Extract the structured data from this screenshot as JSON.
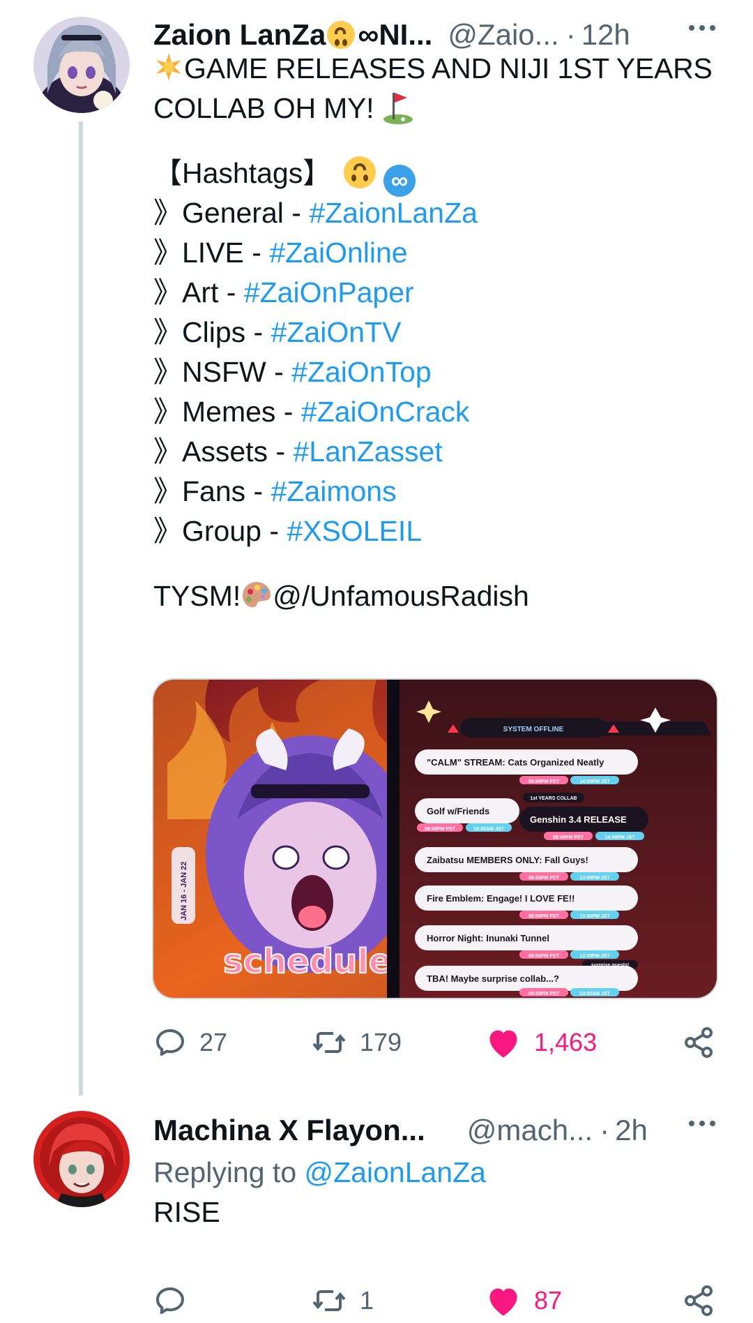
{
  "tweet1": {
    "display_name": "Zaion LanZa",
    "display_name_tail": "NI...",
    "handle": "@Zaio...",
    "separator": "·",
    "time": "12h",
    "lines": {
      "l1": "GAME RELEASES AND NIJI 1ST YEARS",
      "l2": "COLLAB OH MY!",
      "hashtags_header": "【Hashtags】"
    },
    "hashtags": [
      {
        "label": "》General - ",
        "tag": "#ZaionLanZa"
      },
      {
        "label": "》LIVE - ",
        "tag": "#ZaiOnline"
      },
      {
        "label": "》Art - ",
        "tag": "#ZaiOnPaper"
      },
      {
        "label": "》Clips - ",
        "tag": "#ZaiOnTV"
      },
      {
        "label": "》NSFW - ",
        "tag": "#ZaiOnTop"
      },
      {
        "label": "》Memes - ",
        "tag": "#ZaiOnCrack"
      },
      {
        "label": "》Assets - ",
        "tag": "#LanZasset"
      },
      {
        "label": "》Fans - ",
        "tag": "#Zaimons"
      },
      {
        "label": "》Group - ",
        "tag": "#XSOLEIL"
      }
    ],
    "thanks": "TYSM!",
    "credit": "@/UnfamousRadish",
    "media": {
      "title": "schedule",
      "date_range": "JAN 16 - JAN 22",
      "status": "SYSTEM OFFLINE",
      "collab_note": "1st YEARS COLLAB",
      "surprise_note": "surprise guests!",
      "items": [
        {
          "label": "\"CALM\" STREAM: Cats Organized Neatly",
          "pst": "08:00PM PST",
          "jst": "14:00PM JST"
        },
        {
          "label": "Golf w/Friends",
          "pst": "08:00PM PST",
          "jst": "10:00AM JST"
        },
        {
          "label": "Genshin 3.4 RELEASE",
          "pst": "08:00PM PST",
          "jst": "14:00PM JST"
        },
        {
          "label": "Zaibatsu MEMBERS ONLY: Fall Guys!",
          "pst": "08:00PM PST",
          "jst": "13:00PM JST"
        },
        {
          "label": "Fire Emblem: Engage! I LOVE FE!!",
          "pst": "08:00PM PST",
          "jst": "13:00PM JST"
        },
        {
          "label": "Horror Night: Inunaki Tunnel",
          "pst": "08:00PM PST",
          "jst": "13:00PM JST"
        },
        {
          "label": "TBA! Maybe surprise collab...?",
          "pst": "08:00PM PST",
          "jst": "13:00AM JST"
        }
      ]
    },
    "stats": {
      "replies": "27",
      "retweets": "179",
      "likes": "1,463"
    }
  },
  "tweet2": {
    "display_name": "Machina X Flayon...",
    "handle": "@mach...",
    "separator": "·",
    "time": "2h",
    "replying_prefix": "Replying to ",
    "replying_handle": "@ZaionLanZa",
    "text": "RISE",
    "stats": {
      "replies": "",
      "retweets": "1",
      "likes": "87"
    }
  },
  "colors": {
    "link": "#1d9bf0",
    "muted": "#536471",
    "like": "#f91880",
    "thread_line": "#cfd9de"
  },
  "icons": [
    "reply-icon",
    "retweet-icon",
    "like-icon",
    "share-icon",
    "more-icon",
    "sparkle-emoji",
    "golf-flag-emoji",
    "upside-down-face-emoji",
    "infinity-emoji",
    "palette-emoji"
  ]
}
